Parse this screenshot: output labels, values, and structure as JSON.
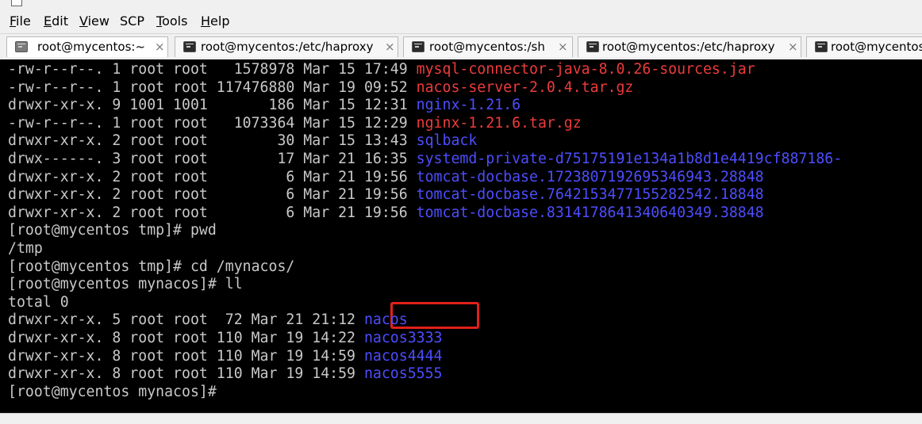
{
  "menu": [
    {
      "id": "file",
      "label": "File",
      "accel": "F",
      "rest": "ile"
    },
    {
      "id": "edit",
      "label": "Edit",
      "accel": "E",
      "rest": "dit"
    },
    {
      "id": "view",
      "label": "View",
      "accel": "V",
      "rest": "iew"
    },
    {
      "id": "scp",
      "label": "SCP",
      "accel": "",
      "rest": "SCP"
    },
    {
      "id": "tools",
      "label": "Tools",
      "accel": "T",
      "rest": "ools"
    },
    {
      "id": "help",
      "label": "Help",
      "accel": "H",
      "rest": "elp"
    }
  ],
  "tabs": [
    {
      "label": "root@mycentos:~",
      "active": true,
      "close": "×"
    },
    {
      "label": "root@mycentos:/etc/haproxy",
      "active": false,
      "close": "×"
    },
    {
      "label": "root@mycentos:/sh",
      "active": false,
      "close": "×"
    },
    {
      "label": "root@mycentos:/etc/haproxy",
      "active": false,
      "close": "×"
    },
    {
      "label": "root@mycentos:",
      "active": false,
      "close": ""
    }
  ],
  "terminal_lines": [
    {
      "text": "-rw-r--r--. 1 root root   1578978 Mar 15 17:49 ",
      "name": "mysql-connector-java-8.0.26-sources.jar",
      "color": "red"
    },
    {
      "text": "-rw-r--r--. 1 root root 117476880 Mar 19 09:52 ",
      "name": "nacos-server-2.0.4.tar.gz",
      "color": "red"
    },
    {
      "text": "drwxr-xr-x. 9 1001 1001       186 Mar 15 12:31 ",
      "name": "nginx-1.21.6",
      "color": "blue"
    },
    {
      "text": "-rw-r--r--. 1 root root   1073364 Mar 15 12:29 ",
      "name": "nginx-1.21.6.tar.gz",
      "color": "red"
    },
    {
      "text": "drwxr-xr-x. 2 root root        30 Mar 15 13:43 ",
      "name": "sqlback",
      "color": "blue"
    },
    {
      "text": "drwx------. 3 root root        17 Mar 21 16:35 ",
      "name": "systemd-private-d75175191e134a1b8d1e4419cf887186-",
      "color": "blue"
    },
    {
      "text": "drwxr-xr-x. 2 root root         6 Mar 21 19:56 ",
      "name": "tomcat-docbase.1723807192695346943.28848",
      "color": "blue"
    },
    {
      "text": "drwxr-xr-x. 2 root root         6 Mar 21 19:56 ",
      "name": "tomcat-docbase.7642153477155282542.18848",
      "color": "blue"
    },
    {
      "text": "drwxr-xr-x. 2 root root         6 Mar 21 19:56 ",
      "name": "tomcat-docbase.8314178641340640349.38848",
      "color": "blue"
    },
    {
      "text": "[root@mycentos tmp]# pwd",
      "name": "",
      "color": ""
    },
    {
      "text": "/tmp",
      "name": "",
      "color": ""
    },
    {
      "text": "[root@mycentos tmp]# cd /mynacos/",
      "name": "",
      "color": ""
    },
    {
      "text": "[root@mycentos mynacos]# ll",
      "name": "",
      "color": ""
    },
    {
      "text": "total 0",
      "name": "",
      "color": ""
    },
    {
      "text": "drwxr-xr-x. 5 root root  72 Mar 21 21:12 ",
      "name": "nacos",
      "color": "blue"
    },
    {
      "text": "drwxr-xr-x. 8 root root 110 Mar 19 14:22 ",
      "name": "nacos3333",
      "color": "blue"
    },
    {
      "text": "drwxr-xr-x. 8 root root 110 Mar 19 14:59 ",
      "name": "nacos4444",
      "color": "blue"
    },
    {
      "text": "drwxr-xr-x. 8 root root 110 Mar 19 14:59 ",
      "name": "nacos5555",
      "color": "blue"
    },
    {
      "text": "[root@mycentos mynacos]# ",
      "name": "",
      "color": ""
    }
  ],
  "colors": {
    "terminal_bg": "#000000",
    "terminal_fg": "#c8c8c8",
    "archive_red": "#ee3b3b",
    "dir_blue": "#4d4dff",
    "highlight_box": "#e0201a"
  }
}
